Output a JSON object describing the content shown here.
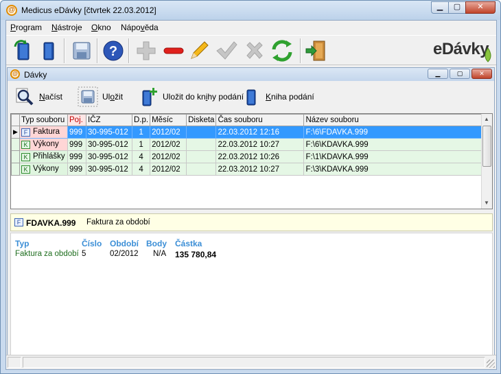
{
  "window": {
    "title": "Medicus eDávky  [čtvrtek 22.03.2012]",
    "controls": {
      "minimize": "▁",
      "maximize": "▢",
      "close": "✕"
    }
  },
  "menu": {
    "items": [
      {
        "label": "Program",
        "accel": "P",
        "rest": "rogram"
      },
      {
        "label": "Nástroje",
        "accel": "N",
        "rest": "ástroje"
      },
      {
        "label": "Okno",
        "accel": "O",
        "rest": "kno"
      },
      {
        "label": "Nápověda",
        "pre": "Nápo",
        "accel": "v",
        "rest": "ěda"
      }
    ]
  },
  "toolbar": {
    "icons": [
      "refresh-book-icon",
      "book-icon",
      "save-disk-icon",
      "help-icon",
      "add-icon",
      "remove-icon",
      "edit-pencil-icon",
      "confirm-check-icon",
      "cancel-x-icon",
      "sync-icon",
      "exit-door-icon"
    ],
    "brand": "eDávky"
  },
  "child_window": {
    "title": "Dávky",
    "toolbar": {
      "load": {
        "accel": "N",
        "rest": "ačíst"
      },
      "save": {
        "pre": "Ul",
        "accel": "o",
        "rest": "žit"
      },
      "save_to_book": {
        "pre": "Uložit do kn",
        "accel": "i",
        "rest": "hy podání"
      },
      "book": {
        "accel": "K",
        "rest": "niha podání"
      }
    }
  },
  "grid": {
    "columns": [
      "Typ souboru",
      "Poj.",
      "IČZ",
      "D.p.",
      "Měsíc",
      "Disketa",
      "Čas souboru",
      "Název souboru"
    ],
    "rows": [
      {
        "badge": "F",
        "type": "Faktura",
        "poj": "999",
        "icz": "30-995-012",
        "dp": "1",
        "month": "2012/02",
        "disk": "",
        "time": "22.03.2012 12:16",
        "name": "F:\\6\\FDAVKA.999",
        "selected": true
      },
      {
        "badge": "K",
        "type": "Výkony",
        "poj": "999",
        "icz": "30-995-012",
        "dp": "1",
        "month": "2012/02",
        "disk": "",
        "time": "22.03.2012 10:27",
        "name": "F:\\6\\KDAVKA.999",
        "selected": false
      },
      {
        "badge": "K",
        "type": "Přihlášky",
        "poj": "999",
        "icz": "30-995-012",
        "dp": "4",
        "month": "2012/02",
        "disk": "",
        "time": "22.03.2012 10:26",
        "name": "F:\\1\\KDAVKA.999",
        "selected": false
      },
      {
        "badge": "K",
        "type": "Výkony",
        "poj": "999",
        "icz": "30-995-012",
        "dp": "4",
        "month": "2012/02",
        "disk": "",
        "time": "22.03.2012 10:27",
        "name": "F:\\3\\KDAVKA.999",
        "selected": false
      }
    ]
  },
  "detail": {
    "badge": "F",
    "file_name": "FDAVKA.999",
    "description": "Faktura za období",
    "headers": {
      "type": "Typ",
      "number": "Číslo",
      "period": "Období",
      "points": "Body",
      "amount": "Částka"
    },
    "values": {
      "type": "Faktura za období",
      "number": "5",
      "period": "02/2012",
      "points": "N/A",
      "amount": "135 780,84"
    }
  }
}
